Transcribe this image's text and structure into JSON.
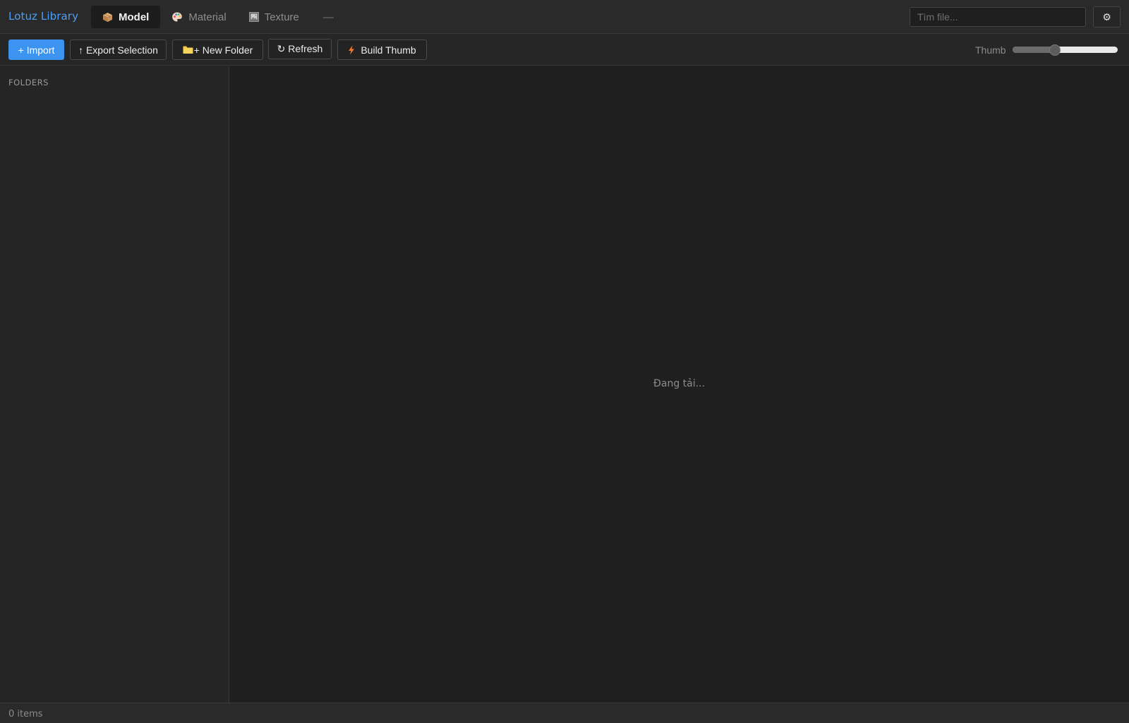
{
  "app": {
    "title": "Lotuz Library"
  },
  "tabs": [
    {
      "label": "Model",
      "icon": "package-icon",
      "active": true
    },
    {
      "label": "Material",
      "icon": "palette-icon",
      "active": false
    },
    {
      "label": "Texture",
      "icon": "picture-frame-icon",
      "active": false
    },
    {
      "label": "—",
      "active": false
    }
  ],
  "search": {
    "placeholder": "Tìm file...",
    "value": ""
  },
  "settings": {
    "icon": "gear-icon",
    "glyph": "⚙"
  },
  "toolbar": {
    "import_label": "+ Import",
    "export_label": "↑ Export Selection",
    "new_folder_label": "+ New Folder",
    "refresh_label": "↻ Refresh",
    "build_thumb_label": "Build Thumb",
    "thumb_label": "Thumb",
    "thumb_level": 0.4
  },
  "sidebar": {
    "heading": "FOLDERS"
  },
  "main": {
    "loading_text": "Đang tải..."
  },
  "status": {
    "items_text": "0 items"
  },
  "colors": {
    "accent": "#3d93f0",
    "title": "#4d9ff5",
    "background": "#1f1f1f",
    "panel": "#252525"
  }
}
